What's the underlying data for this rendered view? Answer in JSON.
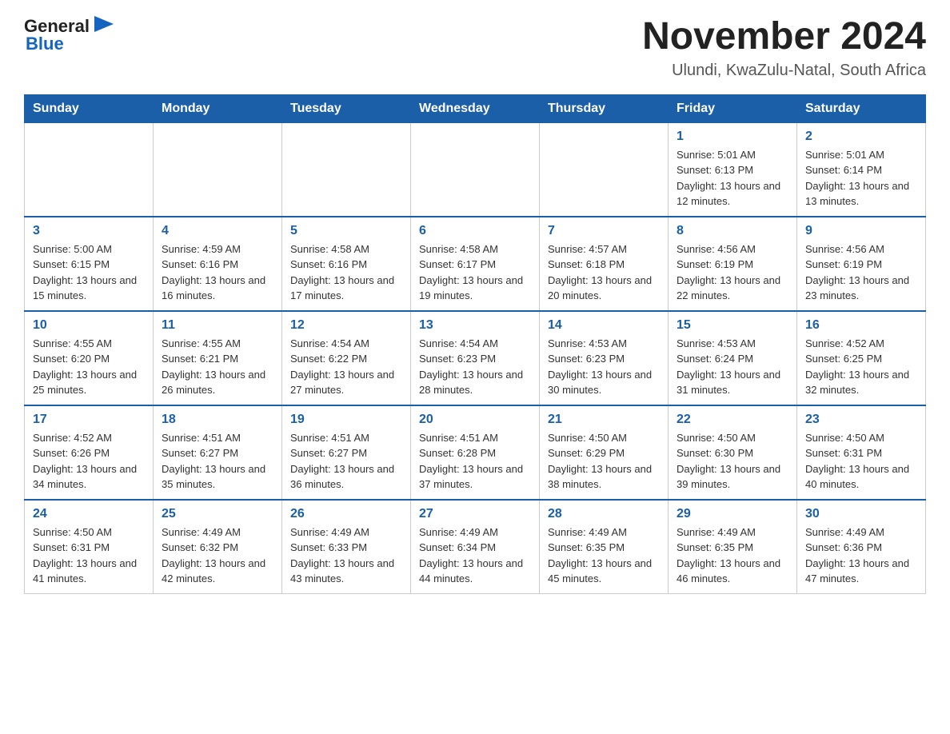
{
  "header": {
    "logo_general": "General",
    "logo_blue": "Blue",
    "month_title": "November 2024",
    "location": "Ulundi, KwaZulu-Natal, South Africa"
  },
  "days_of_week": [
    "Sunday",
    "Monday",
    "Tuesday",
    "Wednesday",
    "Thursday",
    "Friday",
    "Saturday"
  ],
  "weeks": [
    [
      {
        "day": "",
        "sunrise": "",
        "sunset": "",
        "daylight": ""
      },
      {
        "day": "",
        "sunrise": "",
        "sunset": "",
        "daylight": ""
      },
      {
        "day": "",
        "sunrise": "",
        "sunset": "",
        "daylight": ""
      },
      {
        "day": "",
        "sunrise": "",
        "sunset": "",
        "daylight": ""
      },
      {
        "day": "",
        "sunrise": "",
        "sunset": "",
        "daylight": ""
      },
      {
        "day": "1",
        "sunrise": "Sunrise: 5:01 AM",
        "sunset": "Sunset: 6:13 PM",
        "daylight": "Daylight: 13 hours and 12 minutes."
      },
      {
        "day": "2",
        "sunrise": "Sunrise: 5:01 AM",
        "sunset": "Sunset: 6:14 PM",
        "daylight": "Daylight: 13 hours and 13 minutes."
      }
    ],
    [
      {
        "day": "3",
        "sunrise": "Sunrise: 5:00 AM",
        "sunset": "Sunset: 6:15 PM",
        "daylight": "Daylight: 13 hours and 15 minutes."
      },
      {
        "day": "4",
        "sunrise": "Sunrise: 4:59 AM",
        "sunset": "Sunset: 6:16 PM",
        "daylight": "Daylight: 13 hours and 16 minutes."
      },
      {
        "day": "5",
        "sunrise": "Sunrise: 4:58 AM",
        "sunset": "Sunset: 6:16 PM",
        "daylight": "Daylight: 13 hours and 17 minutes."
      },
      {
        "day": "6",
        "sunrise": "Sunrise: 4:58 AM",
        "sunset": "Sunset: 6:17 PM",
        "daylight": "Daylight: 13 hours and 19 minutes."
      },
      {
        "day": "7",
        "sunrise": "Sunrise: 4:57 AM",
        "sunset": "Sunset: 6:18 PM",
        "daylight": "Daylight: 13 hours and 20 minutes."
      },
      {
        "day": "8",
        "sunrise": "Sunrise: 4:56 AM",
        "sunset": "Sunset: 6:19 PM",
        "daylight": "Daylight: 13 hours and 22 minutes."
      },
      {
        "day": "9",
        "sunrise": "Sunrise: 4:56 AM",
        "sunset": "Sunset: 6:19 PM",
        "daylight": "Daylight: 13 hours and 23 minutes."
      }
    ],
    [
      {
        "day": "10",
        "sunrise": "Sunrise: 4:55 AM",
        "sunset": "Sunset: 6:20 PM",
        "daylight": "Daylight: 13 hours and 25 minutes."
      },
      {
        "day": "11",
        "sunrise": "Sunrise: 4:55 AM",
        "sunset": "Sunset: 6:21 PM",
        "daylight": "Daylight: 13 hours and 26 minutes."
      },
      {
        "day": "12",
        "sunrise": "Sunrise: 4:54 AM",
        "sunset": "Sunset: 6:22 PM",
        "daylight": "Daylight: 13 hours and 27 minutes."
      },
      {
        "day": "13",
        "sunrise": "Sunrise: 4:54 AM",
        "sunset": "Sunset: 6:23 PM",
        "daylight": "Daylight: 13 hours and 28 minutes."
      },
      {
        "day": "14",
        "sunrise": "Sunrise: 4:53 AM",
        "sunset": "Sunset: 6:23 PM",
        "daylight": "Daylight: 13 hours and 30 minutes."
      },
      {
        "day": "15",
        "sunrise": "Sunrise: 4:53 AM",
        "sunset": "Sunset: 6:24 PM",
        "daylight": "Daylight: 13 hours and 31 minutes."
      },
      {
        "day": "16",
        "sunrise": "Sunrise: 4:52 AM",
        "sunset": "Sunset: 6:25 PM",
        "daylight": "Daylight: 13 hours and 32 minutes."
      }
    ],
    [
      {
        "day": "17",
        "sunrise": "Sunrise: 4:52 AM",
        "sunset": "Sunset: 6:26 PM",
        "daylight": "Daylight: 13 hours and 34 minutes."
      },
      {
        "day": "18",
        "sunrise": "Sunrise: 4:51 AM",
        "sunset": "Sunset: 6:27 PM",
        "daylight": "Daylight: 13 hours and 35 minutes."
      },
      {
        "day": "19",
        "sunrise": "Sunrise: 4:51 AM",
        "sunset": "Sunset: 6:27 PM",
        "daylight": "Daylight: 13 hours and 36 minutes."
      },
      {
        "day": "20",
        "sunrise": "Sunrise: 4:51 AM",
        "sunset": "Sunset: 6:28 PM",
        "daylight": "Daylight: 13 hours and 37 minutes."
      },
      {
        "day": "21",
        "sunrise": "Sunrise: 4:50 AM",
        "sunset": "Sunset: 6:29 PM",
        "daylight": "Daylight: 13 hours and 38 minutes."
      },
      {
        "day": "22",
        "sunrise": "Sunrise: 4:50 AM",
        "sunset": "Sunset: 6:30 PM",
        "daylight": "Daylight: 13 hours and 39 minutes."
      },
      {
        "day": "23",
        "sunrise": "Sunrise: 4:50 AM",
        "sunset": "Sunset: 6:31 PM",
        "daylight": "Daylight: 13 hours and 40 minutes."
      }
    ],
    [
      {
        "day": "24",
        "sunrise": "Sunrise: 4:50 AM",
        "sunset": "Sunset: 6:31 PM",
        "daylight": "Daylight: 13 hours and 41 minutes."
      },
      {
        "day": "25",
        "sunrise": "Sunrise: 4:49 AM",
        "sunset": "Sunset: 6:32 PM",
        "daylight": "Daylight: 13 hours and 42 minutes."
      },
      {
        "day": "26",
        "sunrise": "Sunrise: 4:49 AM",
        "sunset": "Sunset: 6:33 PM",
        "daylight": "Daylight: 13 hours and 43 minutes."
      },
      {
        "day": "27",
        "sunrise": "Sunrise: 4:49 AM",
        "sunset": "Sunset: 6:34 PM",
        "daylight": "Daylight: 13 hours and 44 minutes."
      },
      {
        "day": "28",
        "sunrise": "Sunrise: 4:49 AM",
        "sunset": "Sunset: 6:35 PM",
        "daylight": "Daylight: 13 hours and 45 minutes."
      },
      {
        "day": "29",
        "sunrise": "Sunrise: 4:49 AM",
        "sunset": "Sunset: 6:35 PM",
        "daylight": "Daylight: 13 hours and 46 minutes."
      },
      {
        "day": "30",
        "sunrise": "Sunrise: 4:49 AM",
        "sunset": "Sunset: 6:36 PM",
        "daylight": "Daylight: 13 hours and 47 minutes."
      }
    ]
  ]
}
